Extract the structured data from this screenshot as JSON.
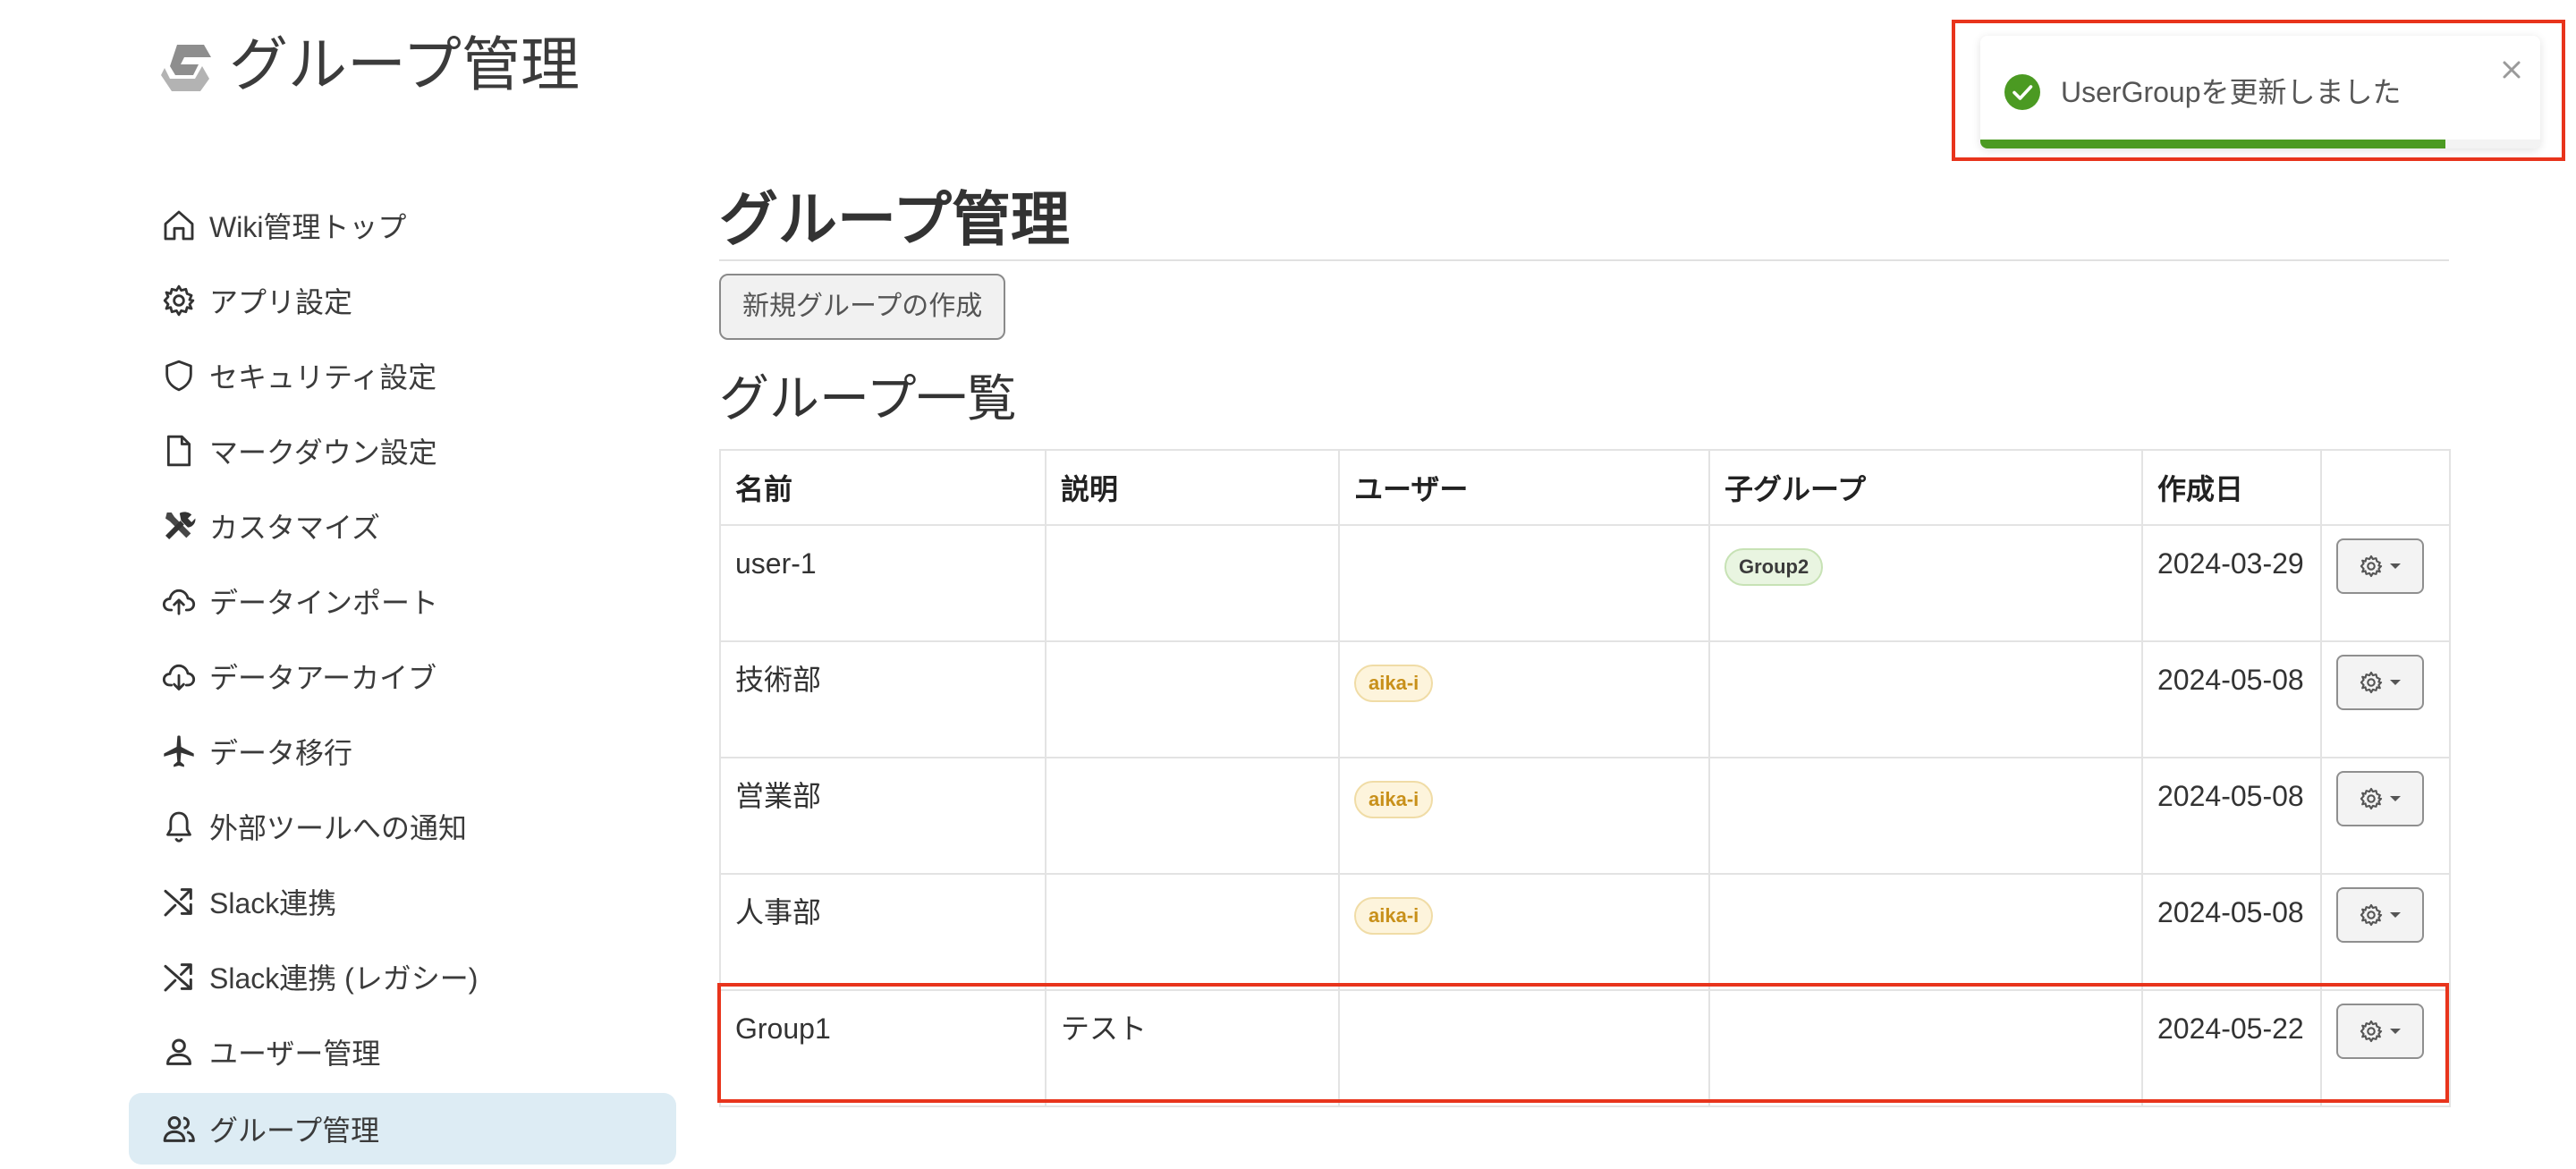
{
  "header": {
    "title": "グループ管理",
    "logo_icon": "growi-logo-icon"
  },
  "sidebar": {
    "items": [
      {
        "label": "Wiki管理トップ",
        "icon": "home-icon",
        "active": false
      },
      {
        "label": "アプリ設定",
        "icon": "gear-icon",
        "active": false
      },
      {
        "label": "セキュリティ設定",
        "icon": "shield-icon",
        "active": false
      },
      {
        "label": "マークダウン設定",
        "icon": "document-icon",
        "active": false
      },
      {
        "label": "カスタマイズ",
        "icon": "tools-icon",
        "active": false
      },
      {
        "label": "データインポート",
        "icon": "cloud-upload-icon",
        "active": false
      },
      {
        "label": "データアーカイブ",
        "icon": "cloud-download-icon",
        "active": false
      },
      {
        "label": "データ移行",
        "icon": "airplane-icon",
        "active": false
      },
      {
        "label": "外部ツールへの通知",
        "icon": "bell-icon",
        "active": false
      },
      {
        "label": "Slack連携",
        "icon": "shuffle-icon",
        "active": false
      },
      {
        "label": "Slack連携 (レガシー)",
        "icon": "shuffle-icon",
        "active": false
      },
      {
        "label": "ユーザー管理",
        "icon": "user-icon",
        "active": false
      },
      {
        "label": "グループ管理",
        "icon": "users-icon",
        "active": true
      }
    ]
  },
  "main": {
    "heading": "グループ管理",
    "new_group_button": "新規グループの作成",
    "list_heading": "グループ一覧",
    "table": {
      "columns": [
        "名前",
        "説明",
        "ユーザー",
        "子グループ",
        "作成日",
        ""
      ],
      "rows": [
        {
          "name": "user-1",
          "description": "",
          "users": [],
          "child_groups": [
            "Group2"
          ],
          "created": "2024-03-29"
        },
        {
          "name": "技術部",
          "description": "",
          "users": [
            "aika-i"
          ],
          "child_groups": [],
          "created": "2024-05-08"
        },
        {
          "name": "営業部",
          "description": "",
          "users": [
            "aika-i"
          ],
          "child_groups": [],
          "created": "2024-05-08"
        },
        {
          "name": "人事部",
          "description": "",
          "users": [
            "aika-i"
          ],
          "child_groups": [],
          "created": "2024-05-08"
        },
        {
          "name": "Group1",
          "description": "テスト",
          "users": [],
          "child_groups": [],
          "created": "2024-05-22"
        }
      ]
    }
  },
  "toast": {
    "message": "UserGroupを更新しました",
    "icon": "check-circle-icon",
    "close_icon": "close-icon",
    "progress": 0.83
  },
  "colors": {
    "accent_active_bg": "#ddecf4",
    "highlight": "#e8341c",
    "success": "#4b9a22",
    "user_badge_text": "#c8901a"
  }
}
